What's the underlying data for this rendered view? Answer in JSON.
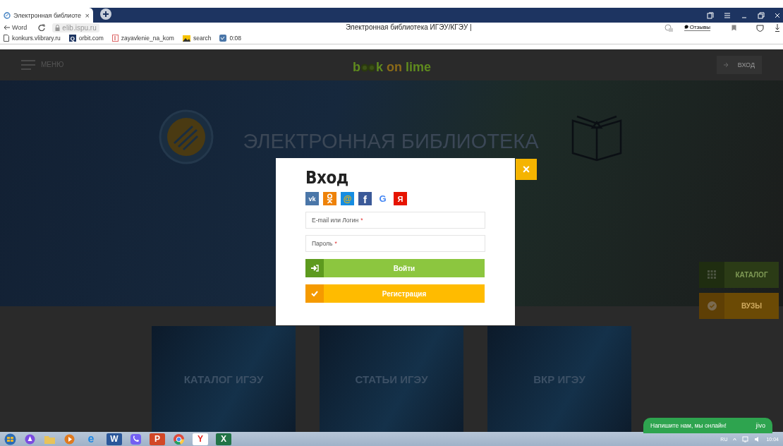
{
  "browser": {
    "tab": {
      "title": "Электронная библиоте",
      "close": "×"
    },
    "back": {
      "label": "Word"
    },
    "url": "elib.ispu.ru",
    "page_title": "Электронная библиотека ИГЭУ/КГЭУ |",
    "reviews": "Отзывы",
    "bookmarks": [
      {
        "kind": "page",
        "label": "konkurs.vlibrary.ru"
      },
      {
        "kind": "q",
        "label": "orbit.com",
        "glyph": "Q"
      },
      {
        "kind": "doc",
        "label": "zayavlenie_na_kom"
      },
      {
        "kind": "image",
        "label": "search"
      },
      {
        "kind": "vk",
        "label": "0:08"
      }
    ]
  },
  "site": {
    "menu": "МЕНЮ",
    "logo": {
      "prefix": "b",
      "suffix": "k",
      "word_1": "on",
      "word_2": "lime"
    },
    "login": "ВХОД",
    "hero_title": "ЭЛЕКТРОННАЯ БИБЛИОТЕКА",
    "side_buttons": [
      {
        "kind": "catalog",
        "label": "КАТАЛОГ"
      },
      {
        "kind": "universities",
        "label": "ВУЗЫ"
      }
    ],
    "tiles": [
      "КАТАЛОГ ИГЭУ",
      "СТАТЬИ ИГЭУ",
      "ВКР ИГЭУ"
    ]
  },
  "modal": {
    "title": "Вход",
    "close": "×",
    "social": [
      {
        "kind": "vk",
        "glyph": "vk"
      },
      {
        "kind": "ok"
      },
      {
        "kind": "mail",
        "glyph": "@"
      },
      {
        "kind": "facebook",
        "glyph": "f"
      },
      {
        "kind": "google",
        "glyph": "G"
      },
      {
        "kind": "yandex",
        "glyph": "Я"
      }
    ],
    "fields": [
      {
        "placeholder": "E-mail или Логин",
        "required_mark": "*"
      },
      {
        "placeholder": "Пароль",
        "required_mark": "*"
      }
    ],
    "buttons": [
      {
        "kind": "login",
        "label": "Войти"
      },
      {
        "kind": "register",
        "label": "Регистрация"
      }
    ]
  },
  "chat": {
    "text": "Напишите нам, мы онлайн!",
    "brand": "jivo"
  },
  "taskbar": {
    "apps": [
      {
        "kind": "start"
      },
      {
        "kind": "alice"
      },
      {
        "kind": "folder"
      },
      {
        "kind": "media"
      },
      {
        "kind": "ie",
        "glyph": "e"
      },
      {
        "kind": "word",
        "glyph": "W"
      },
      {
        "kind": "viber"
      },
      {
        "kind": "powerpoint",
        "glyph": "P"
      },
      {
        "kind": "chrome"
      },
      {
        "kind": "yandex",
        "glyph": "Y"
      },
      {
        "kind": "excel",
        "glyph": "X"
      }
    ],
    "language": "RU",
    "time": "10:04"
  }
}
